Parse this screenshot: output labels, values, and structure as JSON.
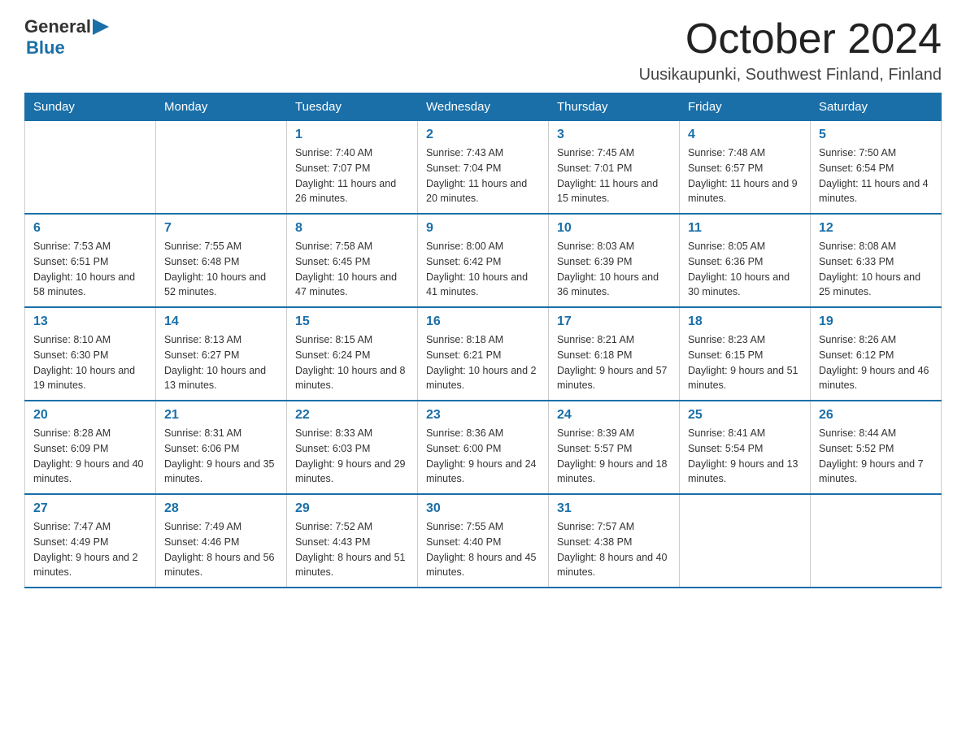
{
  "logo": {
    "general": "General",
    "blue": "Blue"
  },
  "title": "October 2024",
  "location": "Uusikaupunki, Southwest Finland, Finland",
  "weekdays": [
    "Sunday",
    "Monday",
    "Tuesday",
    "Wednesday",
    "Thursday",
    "Friday",
    "Saturday"
  ],
  "weeks": [
    [
      {
        "day": "",
        "sunrise": "",
        "sunset": "",
        "daylight": ""
      },
      {
        "day": "",
        "sunrise": "",
        "sunset": "",
        "daylight": ""
      },
      {
        "day": "1",
        "sunrise": "Sunrise: 7:40 AM",
        "sunset": "Sunset: 7:07 PM",
        "daylight": "Daylight: 11 hours and 26 minutes."
      },
      {
        "day": "2",
        "sunrise": "Sunrise: 7:43 AM",
        "sunset": "Sunset: 7:04 PM",
        "daylight": "Daylight: 11 hours and 20 minutes."
      },
      {
        "day": "3",
        "sunrise": "Sunrise: 7:45 AM",
        "sunset": "Sunset: 7:01 PM",
        "daylight": "Daylight: 11 hours and 15 minutes."
      },
      {
        "day": "4",
        "sunrise": "Sunrise: 7:48 AM",
        "sunset": "Sunset: 6:57 PM",
        "daylight": "Daylight: 11 hours and 9 minutes."
      },
      {
        "day": "5",
        "sunrise": "Sunrise: 7:50 AM",
        "sunset": "Sunset: 6:54 PM",
        "daylight": "Daylight: 11 hours and 4 minutes."
      }
    ],
    [
      {
        "day": "6",
        "sunrise": "Sunrise: 7:53 AM",
        "sunset": "Sunset: 6:51 PM",
        "daylight": "Daylight: 10 hours and 58 minutes."
      },
      {
        "day": "7",
        "sunrise": "Sunrise: 7:55 AM",
        "sunset": "Sunset: 6:48 PM",
        "daylight": "Daylight: 10 hours and 52 minutes."
      },
      {
        "day": "8",
        "sunrise": "Sunrise: 7:58 AM",
        "sunset": "Sunset: 6:45 PM",
        "daylight": "Daylight: 10 hours and 47 minutes."
      },
      {
        "day": "9",
        "sunrise": "Sunrise: 8:00 AM",
        "sunset": "Sunset: 6:42 PM",
        "daylight": "Daylight: 10 hours and 41 minutes."
      },
      {
        "day": "10",
        "sunrise": "Sunrise: 8:03 AM",
        "sunset": "Sunset: 6:39 PM",
        "daylight": "Daylight: 10 hours and 36 minutes."
      },
      {
        "day": "11",
        "sunrise": "Sunrise: 8:05 AM",
        "sunset": "Sunset: 6:36 PM",
        "daylight": "Daylight: 10 hours and 30 minutes."
      },
      {
        "day": "12",
        "sunrise": "Sunrise: 8:08 AM",
        "sunset": "Sunset: 6:33 PM",
        "daylight": "Daylight: 10 hours and 25 minutes."
      }
    ],
    [
      {
        "day": "13",
        "sunrise": "Sunrise: 8:10 AM",
        "sunset": "Sunset: 6:30 PM",
        "daylight": "Daylight: 10 hours and 19 minutes."
      },
      {
        "day": "14",
        "sunrise": "Sunrise: 8:13 AM",
        "sunset": "Sunset: 6:27 PM",
        "daylight": "Daylight: 10 hours and 13 minutes."
      },
      {
        "day": "15",
        "sunrise": "Sunrise: 8:15 AM",
        "sunset": "Sunset: 6:24 PM",
        "daylight": "Daylight: 10 hours and 8 minutes."
      },
      {
        "day": "16",
        "sunrise": "Sunrise: 8:18 AM",
        "sunset": "Sunset: 6:21 PM",
        "daylight": "Daylight: 10 hours and 2 minutes."
      },
      {
        "day": "17",
        "sunrise": "Sunrise: 8:21 AM",
        "sunset": "Sunset: 6:18 PM",
        "daylight": "Daylight: 9 hours and 57 minutes."
      },
      {
        "day": "18",
        "sunrise": "Sunrise: 8:23 AM",
        "sunset": "Sunset: 6:15 PM",
        "daylight": "Daylight: 9 hours and 51 minutes."
      },
      {
        "day": "19",
        "sunrise": "Sunrise: 8:26 AM",
        "sunset": "Sunset: 6:12 PM",
        "daylight": "Daylight: 9 hours and 46 minutes."
      }
    ],
    [
      {
        "day": "20",
        "sunrise": "Sunrise: 8:28 AM",
        "sunset": "Sunset: 6:09 PM",
        "daylight": "Daylight: 9 hours and 40 minutes."
      },
      {
        "day": "21",
        "sunrise": "Sunrise: 8:31 AM",
        "sunset": "Sunset: 6:06 PM",
        "daylight": "Daylight: 9 hours and 35 minutes."
      },
      {
        "day": "22",
        "sunrise": "Sunrise: 8:33 AM",
        "sunset": "Sunset: 6:03 PM",
        "daylight": "Daylight: 9 hours and 29 minutes."
      },
      {
        "day": "23",
        "sunrise": "Sunrise: 8:36 AM",
        "sunset": "Sunset: 6:00 PM",
        "daylight": "Daylight: 9 hours and 24 minutes."
      },
      {
        "day": "24",
        "sunrise": "Sunrise: 8:39 AM",
        "sunset": "Sunset: 5:57 PM",
        "daylight": "Daylight: 9 hours and 18 minutes."
      },
      {
        "day": "25",
        "sunrise": "Sunrise: 8:41 AM",
        "sunset": "Sunset: 5:54 PM",
        "daylight": "Daylight: 9 hours and 13 minutes."
      },
      {
        "day": "26",
        "sunrise": "Sunrise: 8:44 AM",
        "sunset": "Sunset: 5:52 PM",
        "daylight": "Daylight: 9 hours and 7 minutes."
      }
    ],
    [
      {
        "day": "27",
        "sunrise": "Sunrise: 7:47 AM",
        "sunset": "Sunset: 4:49 PM",
        "daylight": "Daylight: 9 hours and 2 minutes."
      },
      {
        "day": "28",
        "sunrise": "Sunrise: 7:49 AM",
        "sunset": "Sunset: 4:46 PM",
        "daylight": "Daylight: 8 hours and 56 minutes."
      },
      {
        "day": "29",
        "sunrise": "Sunrise: 7:52 AM",
        "sunset": "Sunset: 4:43 PM",
        "daylight": "Daylight: 8 hours and 51 minutes."
      },
      {
        "day": "30",
        "sunrise": "Sunrise: 7:55 AM",
        "sunset": "Sunset: 4:40 PM",
        "daylight": "Daylight: 8 hours and 45 minutes."
      },
      {
        "day": "31",
        "sunrise": "Sunrise: 7:57 AM",
        "sunset": "Sunset: 4:38 PM",
        "daylight": "Daylight: 8 hours and 40 minutes."
      },
      {
        "day": "",
        "sunrise": "",
        "sunset": "",
        "daylight": ""
      },
      {
        "day": "",
        "sunrise": "",
        "sunset": "",
        "daylight": ""
      }
    ]
  ]
}
